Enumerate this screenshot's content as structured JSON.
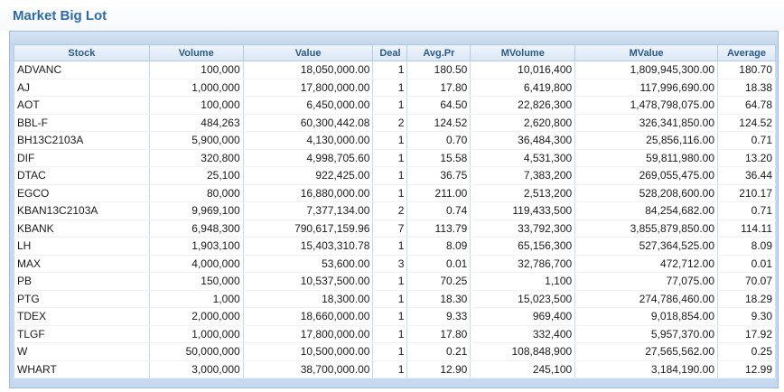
{
  "title": "Market Big Lot",
  "columns": [
    "Stock",
    "Volume",
    "Value",
    "Deal",
    "Avg.Pr",
    "MVolume",
    "MValue",
    "Average"
  ],
  "rows": [
    [
      "ADVANC",
      "100,000",
      "18,050,000.00",
      "1",
      "180.50",
      "10,016,400",
      "1,809,945,300.00",
      "180.70"
    ],
    [
      "AJ",
      "1,000,000",
      "17,800,000.00",
      "1",
      "17.80",
      "6,419,800",
      "117,996,690.00",
      "18.38"
    ],
    [
      "AOT",
      "100,000",
      "6,450,000.00",
      "1",
      "64.50",
      "22,826,300",
      "1,478,798,075.00",
      "64.78"
    ],
    [
      "BBL-F",
      "484,263",
      "60,300,442.08",
      "2",
      "124.52",
      "2,620,800",
      "326,341,850.00",
      "124.52"
    ],
    [
      "BH13C2103A",
      "5,900,000",
      "4,130,000.00",
      "1",
      "0.70",
      "36,484,300",
      "25,856,116.00",
      "0.71"
    ],
    [
      "DIF",
      "320,800",
      "4,998,705.60",
      "1",
      "15.58",
      "4,531,300",
      "59,811,980.00",
      "13.20"
    ],
    [
      "DTAC",
      "25,100",
      "922,425.00",
      "1",
      "36.75",
      "7,383,200",
      "269,055,475.00",
      "36.44"
    ],
    [
      "EGCO",
      "80,000",
      "16,880,000.00",
      "1",
      "211.00",
      "2,513,200",
      "528,208,600.00",
      "210.17"
    ],
    [
      "KBAN13C2103A",
      "9,969,100",
      "7,377,134.00",
      "2",
      "0.74",
      "119,433,500",
      "84,254,682.00",
      "0.71"
    ],
    [
      "KBANK",
      "6,948,300",
      "790,617,159.96",
      "7",
      "113.79",
      "33,792,300",
      "3,855,879,850.00",
      "114.11"
    ],
    [
      "LH",
      "1,903,100",
      "15,403,310.78",
      "1",
      "8.09",
      "65,156,300",
      "527,364,525.00",
      "8.09"
    ],
    [
      "MAX",
      "4,000,000",
      "53,600.00",
      "3",
      "0.01",
      "32,786,700",
      "472,712.00",
      "0.01"
    ],
    [
      "PB",
      "150,000",
      "10,537,500.00",
      "1",
      "70.25",
      "1,100",
      "77,075.00",
      "70.07"
    ],
    [
      "PTG",
      "1,000",
      "18,300.00",
      "1",
      "18.30",
      "15,023,500",
      "274,786,460.00",
      "18.29"
    ],
    [
      "TDEX",
      "2,000,000",
      "18,660,000.00",
      "1",
      "9.33",
      "969,400",
      "9,018,854.00",
      "9.30"
    ],
    [
      "TLGF",
      "1,000,000",
      "17,800,000.00",
      "1",
      "17.80",
      "332,400",
      "5,957,370.00",
      "17.92"
    ],
    [
      "W",
      "50,000,000",
      "10,500,000.00",
      "1",
      "0.21",
      "108,848,900",
      "27,565,562.00",
      "0.25"
    ],
    [
      "WHART",
      "3,000,000",
      "38,700,000.00",
      "1",
      "12.90",
      "245,100",
      "3,184,190.00",
      "12.99"
    ]
  ],
  "colors": {
    "title": "#2d6aa8",
    "header_text": "#2a5a8a",
    "frame": "#c7d9ee"
  }
}
